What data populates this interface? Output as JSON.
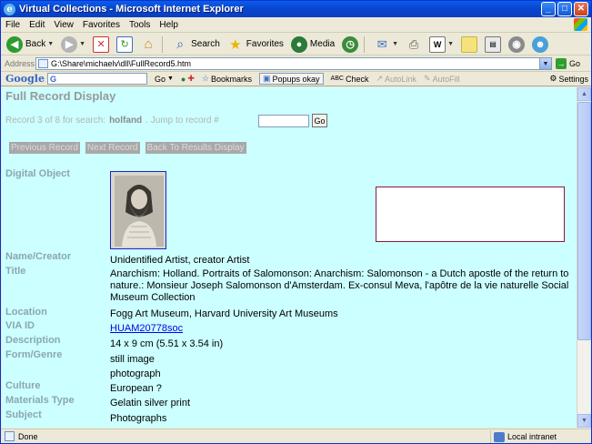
{
  "window": {
    "title": "Virtual Collections - Microsoft Internet Explorer",
    "buttons": [
      "_",
      "□",
      "✕"
    ]
  },
  "menubar": {
    "items": [
      "File",
      "Edit",
      "View",
      "Favorites",
      "Tools",
      "Help"
    ]
  },
  "toolbar": {
    "back_label": "Back",
    "search_label": "Search",
    "favorites_label": "Favorites",
    "media_label": "Media"
  },
  "addressbar": {
    "label": "Address",
    "url": "G:\\Share\\michaelv\\dll\\FullRecord5.htm",
    "go_label": "Go"
  },
  "googlebar": {
    "logo": "Google",
    "box_value": "G",
    "go_label": "Go",
    "bookmarks_label": "Bookmarks",
    "popups_label": "Popups okay",
    "check_label": "Check",
    "autolink_label": "AutoLink",
    "autofill_label": "AutoFill",
    "settings_label": "Settings"
  },
  "page": {
    "heading": "Full Record Display",
    "search_prefix": "Record 3 of 8  for search:",
    "search_term": "holfand",
    "jump_label": ". Jump to record #",
    "jump_go": "Go",
    "nav_buttons": [
      "Previous Record",
      "Next Record",
      "Back To Results Display"
    ],
    "fields": {
      "digital_object_label": "Digital Object",
      "name_label": "Name/Creator",
      "name_value": "Unidentified Artist,  creator Artist",
      "title_label": "Title",
      "title_value": "Anarchism: Holland. Portraits of Salomonson: Anarchism: Salomonson - a Dutch apostle of the return to nature.: Monsieur Joseph Salomonson d'Amsterdam. Ex-consul Meva, l'apôtre de la vie naturelle Social Museum Collection",
      "location_label": "Location",
      "location_value": "Fogg Art Museum, Harvard University Art Museums",
      "via_label": "VIA ID",
      "via_value": "HUAM20778soc",
      "description_label": "Description",
      "description_value": "14 x 9 cm (5.51 x 3.54 in)",
      "form_label": "Form/Genre",
      "form_value_1": "still image",
      "form_value_2": "photograph",
      "culture_label": "Culture",
      "culture_value": "European ?",
      "materials_label": "Materials Type",
      "materials_value": "Gelatin silver print",
      "subject_label": "Subject",
      "subject_value": "Photographs"
    }
  },
  "statusbar": {
    "status": "Done",
    "zone": "Local intranet"
  },
  "colors": {
    "page_background": "#ccffff",
    "label_color": "#8aa6b4",
    "heading_color": "#999999",
    "link_color": "#0000ee",
    "titlebar_blue": "#0846d0"
  }
}
